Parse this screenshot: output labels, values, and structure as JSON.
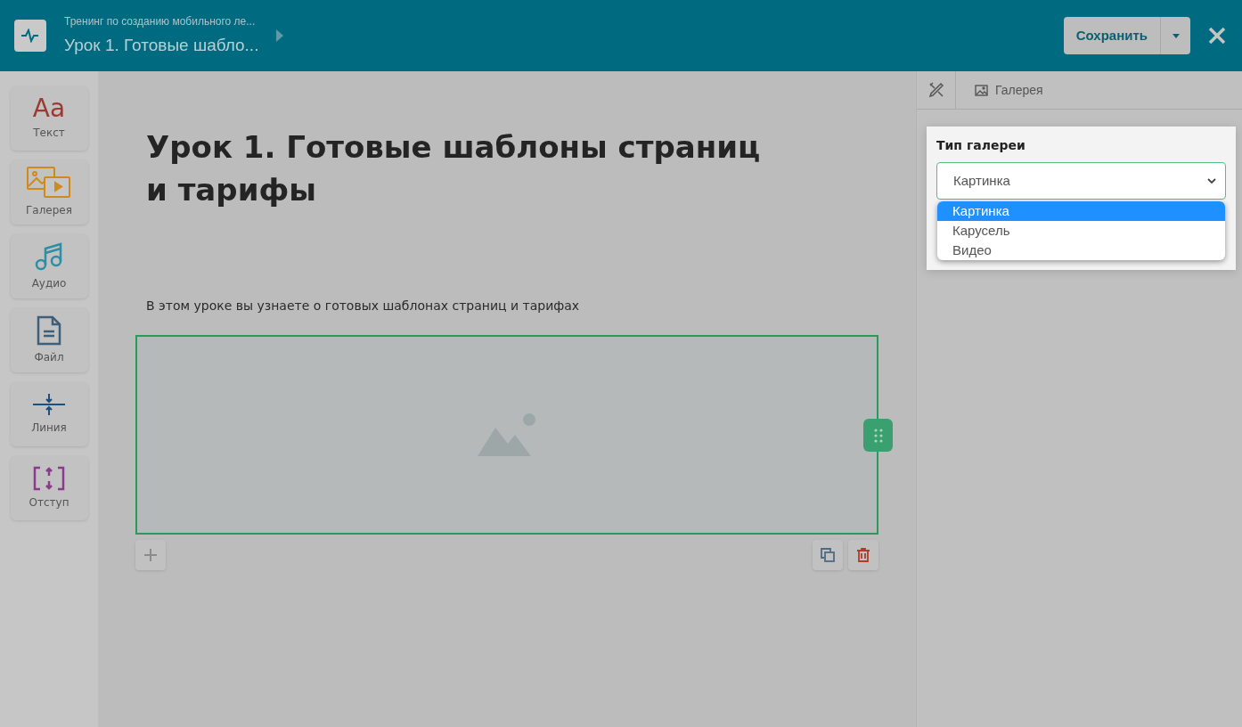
{
  "header": {
    "course": "Тренинг по созданию мобильного ле...",
    "lesson": "Урок 1. Готовые шабло...",
    "save_button": "Сохранить"
  },
  "tools": [
    {
      "kind": "text",
      "label": "Текст",
      "glyph": "Aa"
    },
    {
      "kind": "gallery",
      "label": "Галерея"
    },
    {
      "kind": "audio",
      "label": "Аудио"
    },
    {
      "kind": "file",
      "label": "Файл"
    },
    {
      "kind": "line",
      "label": "Линия"
    },
    {
      "kind": "spacing",
      "label": "Отступ"
    }
  ],
  "lesson": {
    "title": "Урок 1. Готовые шаблоны страниц и тарифы",
    "description": "В этом уроке вы узнаете о готовых шаблонах страниц и тарифах"
  },
  "panel": {
    "breadcrumb": "Галерея",
    "field_label": "Тип галереи",
    "value": "Картинка",
    "options": [
      {
        "label": "Картинка",
        "selected": true
      },
      {
        "label": "Карусель",
        "selected": false
      },
      {
        "label": "Видео",
        "selected": false
      }
    ]
  }
}
